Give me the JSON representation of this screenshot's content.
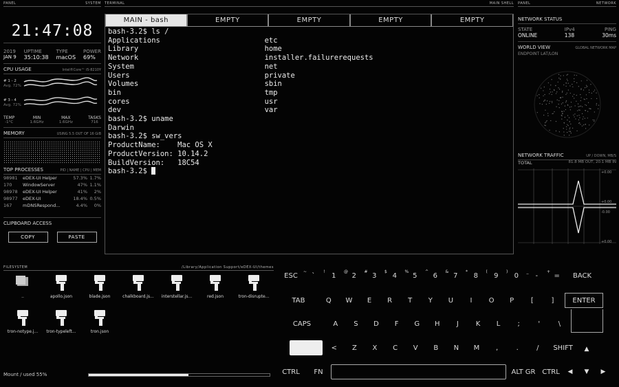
{
  "panel_left": {
    "header_left": "PANEL",
    "header_right": "SYSTEM",
    "clock": "21:47:08",
    "year": "2019",
    "date": "JAN 9",
    "uptime_label": "UPTIME",
    "uptime": "35:10:38",
    "type_label": "TYPE",
    "type": "macOS",
    "power_label": "POWER",
    "power": "69%",
    "cpu_title": "CPU USAGE",
    "cpu_model": "Intel®Core™ i5-8210Y",
    "cpu_rows": [
      {
        "label": "# 1 - 2",
        "avg": "Avg. 72%"
      },
      {
        "label": "# 3 - 4",
        "avg": "Avg. 72%"
      }
    ],
    "stats": [
      {
        "l": "TEMP",
        "v": "-1°C"
      },
      {
        "l": "MIN",
        "v": "1.6GHz"
      },
      {
        "l": "MAX",
        "v": "1.6GHz"
      },
      {
        "l": "TASKS",
        "v": "716"
      }
    ],
    "memory_title": "MEMORY",
    "memory_sub": "USING 5.5 OUT OF 16 GiB",
    "proc_title": "TOP PROCESSES",
    "proc_sub": "PID | NAME | CPU | MEM",
    "processes": [
      [
        "98981",
        "eDEX-UI Helper",
        "57.3%",
        "1.7%"
      ],
      [
        "170",
        "WindowServer",
        "47%",
        "1.1%"
      ],
      [
        "98978",
        "eDEX-UI Helper",
        "41%",
        "2%"
      ],
      [
        "98977",
        "eDEX-UI",
        "18.4%",
        "0.5%"
      ],
      [
        "167",
        "mDNSRespond...",
        "4.4%",
        "0%"
      ]
    ],
    "clip_title": "CLIPBOARD ACCESS",
    "copy": "COPY",
    "paste": "PASTE"
  },
  "terminal": {
    "header_left": "TERMINAL",
    "header_right": "MAIN SHELL",
    "tabs": [
      "MAIN - bash",
      "EMPTY",
      "EMPTY",
      "EMPTY",
      "EMPTY"
    ],
    "lines": [
      "bash-3.2$ ls /",
      "Applications                        etc",
      "Library                             home",
      "Network                             installer.failurerequests",
      "System                              net",
      "Users                               private",
      "Volumes                             sbin",
      "bin                                 tmp",
      "cores                               usr",
      "dev                                 var",
      "bash-3.2$ uname",
      "Darwin",
      "bash-3.2$ sw_vers",
      "ProductName:    Mac OS X",
      "ProductVersion: 10.14.2",
      "BuildVersion:   18C54"
    ],
    "prompt": "bash-3.2$ "
  },
  "panel_right": {
    "header_left": "PANEL",
    "header_right": "NETWORK",
    "status_title": "NETWORK STATUS",
    "state_l": "STATE",
    "state": "ONLINE",
    "ipv_l": "IPv4",
    "ip": "138",
    "ping_l": "PING",
    "ping": "30ms",
    "world_title": "WORLD VIEW",
    "world_sub": "GLOBAL NETWORK MAP",
    "world_sub2": "ENDPOINT LAT/LON",
    "traffic_title": "NETWORK TRAFFIC",
    "traffic_sub": "UP / DOWN, MB/S",
    "total_l": "TOTAL",
    "total": "81.8 MB OUT, 20.1 MB IN",
    "axis": [
      "+0.00",
      "+0.00",
      "-0.00",
      "+0.00"
    ]
  },
  "filesystem": {
    "header_left": "FILESYSTEM",
    "header_right": "/Library/Application Support/eDEX-UI/themes",
    "files": [
      "..",
      "apollo.json",
      "blade.json",
      "chalkboard.js...",
      "interstellar.js...",
      "red.json",
      "tron-disrupte...",
      "tron-notype.j...",
      "tron-typeleft...",
      "tron.json"
    ],
    "mount": "Mount / used 55%",
    "used": 0.55
  },
  "keyboard": {
    "r1": [
      [
        "ESC",
        ""
      ],
      [
        "`",
        "~"
      ],
      [
        "1",
        "!"
      ],
      [
        "2",
        "@"
      ],
      [
        "3",
        "#"
      ],
      [
        "4",
        "$"
      ],
      [
        "5",
        "%"
      ],
      [
        "6",
        "^"
      ],
      [
        "7",
        "&"
      ],
      [
        "8",
        "*"
      ],
      [
        "9",
        "("
      ],
      [
        "0",
        ")"
      ],
      [
        "-",
        "_"
      ],
      [
        "=",
        "+"
      ],
      [
        "BACK",
        ""
      ]
    ],
    "r2": [
      "TAB",
      "Q",
      "W",
      "E",
      "R",
      "T",
      "Y",
      "U",
      "I",
      "O",
      "P",
      "[",
      "]"
    ],
    "enter": "ENTER",
    "r3": [
      "CAPS",
      "A",
      "S",
      "D",
      "F",
      "G",
      "H",
      "J",
      "K",
      "L",
      ";",
      "'",
      "\\"
    ],
    "r4": [
      "<",
      "Z",
      "X",
      "C",
      "V",
      "B",
      "N",
      "M",
      ",",
      ".",
      "/",
      "SHIFT"
    ],
    "r5": [
      "CTRL",
      "FN",
      "ALT GR",
      "CTRL"
    ]
  }
}
